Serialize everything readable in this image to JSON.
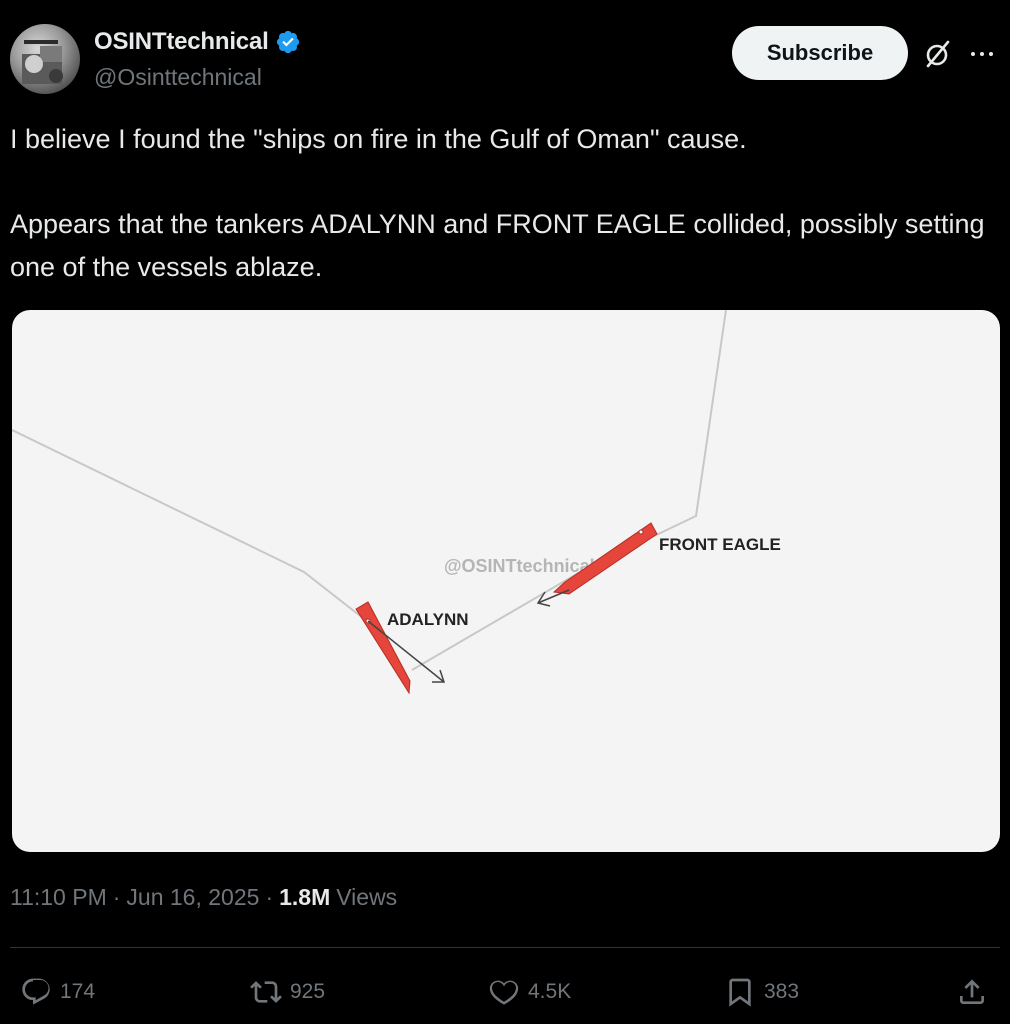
{
  "author": {
    "display_name": "OSINTtechnical",
    "handle": "@Osinttechnical",
    "verified": true
  },
  "subscribe_label": "Subscribe",
  "tweet": {
    "paragraph1": "I believe I found the \"ships on fire in the Gulf of Oman\" cause.",
    "paragraph2": "Appears that the tankers ADALYNN and FRONT EAGLE collided, possibly setting one of the vessels ablaze."
  },
  "media": {
    "watermark": "@OSINTtechnical",
    "ship1_label": "FRONT EAGLE",
    "ship2_label": "ADALYNN",
    "ship_color": "#e5453a"
  },
  "meta": {
    "time": "11:10 PM",
    "dot1": "·",
    "date": "Jun 16, 2025",
    "dot2": "·",
    "views_count": "1.8M",
    "views_label": "Views"
  },
  "actions": {
    "replies": "174",
    "reposts": "925",
    "likes": "4.5K",
    "bookmarks": "383"
  },
  "icons": [
    "verified-badge-icon",
    "grok-icon",
    "more-icon",
    "reply-icon",
    "repost-icon",
    "like-icon",
    "bookmark-icon",
    "share-icon"
  ],
  "colors": {
    "background": "#000000",
    "text": "#e7e9ea",
    "muted": "#71767b",
    "verified": "#1d9bf0"
  }
}
